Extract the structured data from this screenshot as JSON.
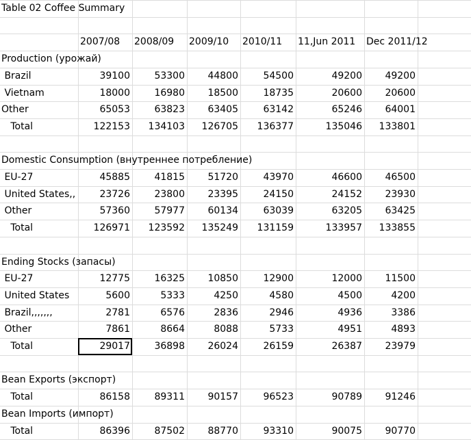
{
  "sheet": {
    "title": "Table 02 Coffee Summary",
    "headers": [
      "2007/08",
      "2008/09",
      "2009/10",
      "2010/11",
      "11,Jun 2011",
      "Dec 2011/12"
    ],
    "rows": [
      {
        "label": "Table 02 Coffee Summary",
        "values": [],
        "kind": "title"
      },
      {
        "label": "",
        "values": [],
        "kind": "blank"
      },
      {
        "label": "",
        "values": [
          "2007/08",
          "2008/09",
          "2009/10",
          "2010/11",
          "11,Jun 2011",
          "Dec 2011/12"
        ],
        "kind": "header"
      },
      {
        "label": "Production (урожай)",
        "values": [],
        "kind": "section"
      },
      {
        "label": " Brazil",
        "values": [
          "39100",
          "53300",
          "44800",
          "54500",
          "49200",
          "49200"
        ],
        "kind": "data"
      },
      {
        "label": " Vietnam",
        "values": [
          "18000",
          "16980",
          "18500",
          "18735",
          "20600",
          "20600"
        ],
        "kind": "data"
      },
      {
        "label": "Other",
        "values": [
          "65053",
          "63823",
          "63405",
          "63142",
          "65246",
          "64001"
        ],
        "kind": "data"
      },
      {
        "label": "   Total",
        "values": [
          "122153",
          "134103",
          "126705",
          "136377",
          "135046",
          "133801"
        ],
        "kind": "data"
      },
      {
        "label": "",
        "values": [],
        "kind": "blank"
      },
      {
        "label": "Domestic Consumption (внутреннее потребление)",
        "values": [],
        "kind": "section"
      },
      {
        "label": " EU-27",
        "values": [
          "45885",
          "41815",
          "51720",
          "43970",
          "46600",
          "46500"
        ],
        "kind": "data"
      },
      {
        "label": " United States,,",
        "values": [
          "23726",
          "23800",
          "23395",
          "24150",
          "24152",
          "23930"
        ],
        "kind": "data"
      },
      {
        "label": " Other",
        "values": [
          "57360",
          "57977",
          "60134",
          "63039",
          "63205",
          "63425"
        ],
        "kind": "data"
      },
      {
        "label": "   Total",
        "values": [
          "126971",
          "123592",
          "135249",
          "131159",
          "133957",
          "133855"
        ],
        "kind": "data"
      },
      {
        "label": "",
        "values": [],
        "kind": "blank"
      },
      {
        "label": "Ending Stocks (запасы)",
        "values": [],
        "kind": "section"
      },
      {
        "label": " EU-27",
        "values": [
          "12775",
          "16325",
          "10850",
          "12900",
          "12000",
          "11500"
        ],
        "kind": "data"
      },
      {
        "label": " United States",
        "values": [
          "5600",
          "5333",
          "4250",
          "4580",
          "4500",
          "4200"
        ],
        "kind": "data"
      },
      {
        "label": " Brazil,,,,,,,",
        "values": [
          "2781",
          "6576",
          "2836",
          "2946",
          "4936",
          "3386"
        ],
        "kind": "data"
      },
      {
        "label": " Other",
        "values": [
          "7861",
          "8664",
          "8088",
          "5733",
          "4951",
          "4893"
        ],
        "kind": "data"
      },
      {
        "label": "   Total",
        "values": [
          "29017",
          "36898",
          "26024",
          "26159",
          "26387",
          "23979"
        ],
        "kind": "data"
      },
      {
        "label": "",
        "values": [],
        "kind": "blank"
      },
      {
        "label": "Bean Exports (экспорт)",
        "values": [],
        "kind": "section"
      },
      {
        "label": "   Total",
        "values": [
          "86158",
          "89311",
          "90157",
          "96523",
          "90789",
          "91246"
        ],
        "kind": "data"
      },
      {
        "label": "Bean Imports (импорт)",
        "values": [],
        "kind": "section"
      },
      {
        "label": "   Total",
        "values": [
          "86396",
          "87502",
          "88770",
          "93310",
          "90075",
          "90770"
        ],
        "kind": "data"
      }
    ],
    "selected_cell": {
      "row": 20,
      "col": 1
    }
  },
  "colors": {
    "gridline": "#dcdcdc",
    "selection": "#000000",
    "text": "#000000"
  }
}
